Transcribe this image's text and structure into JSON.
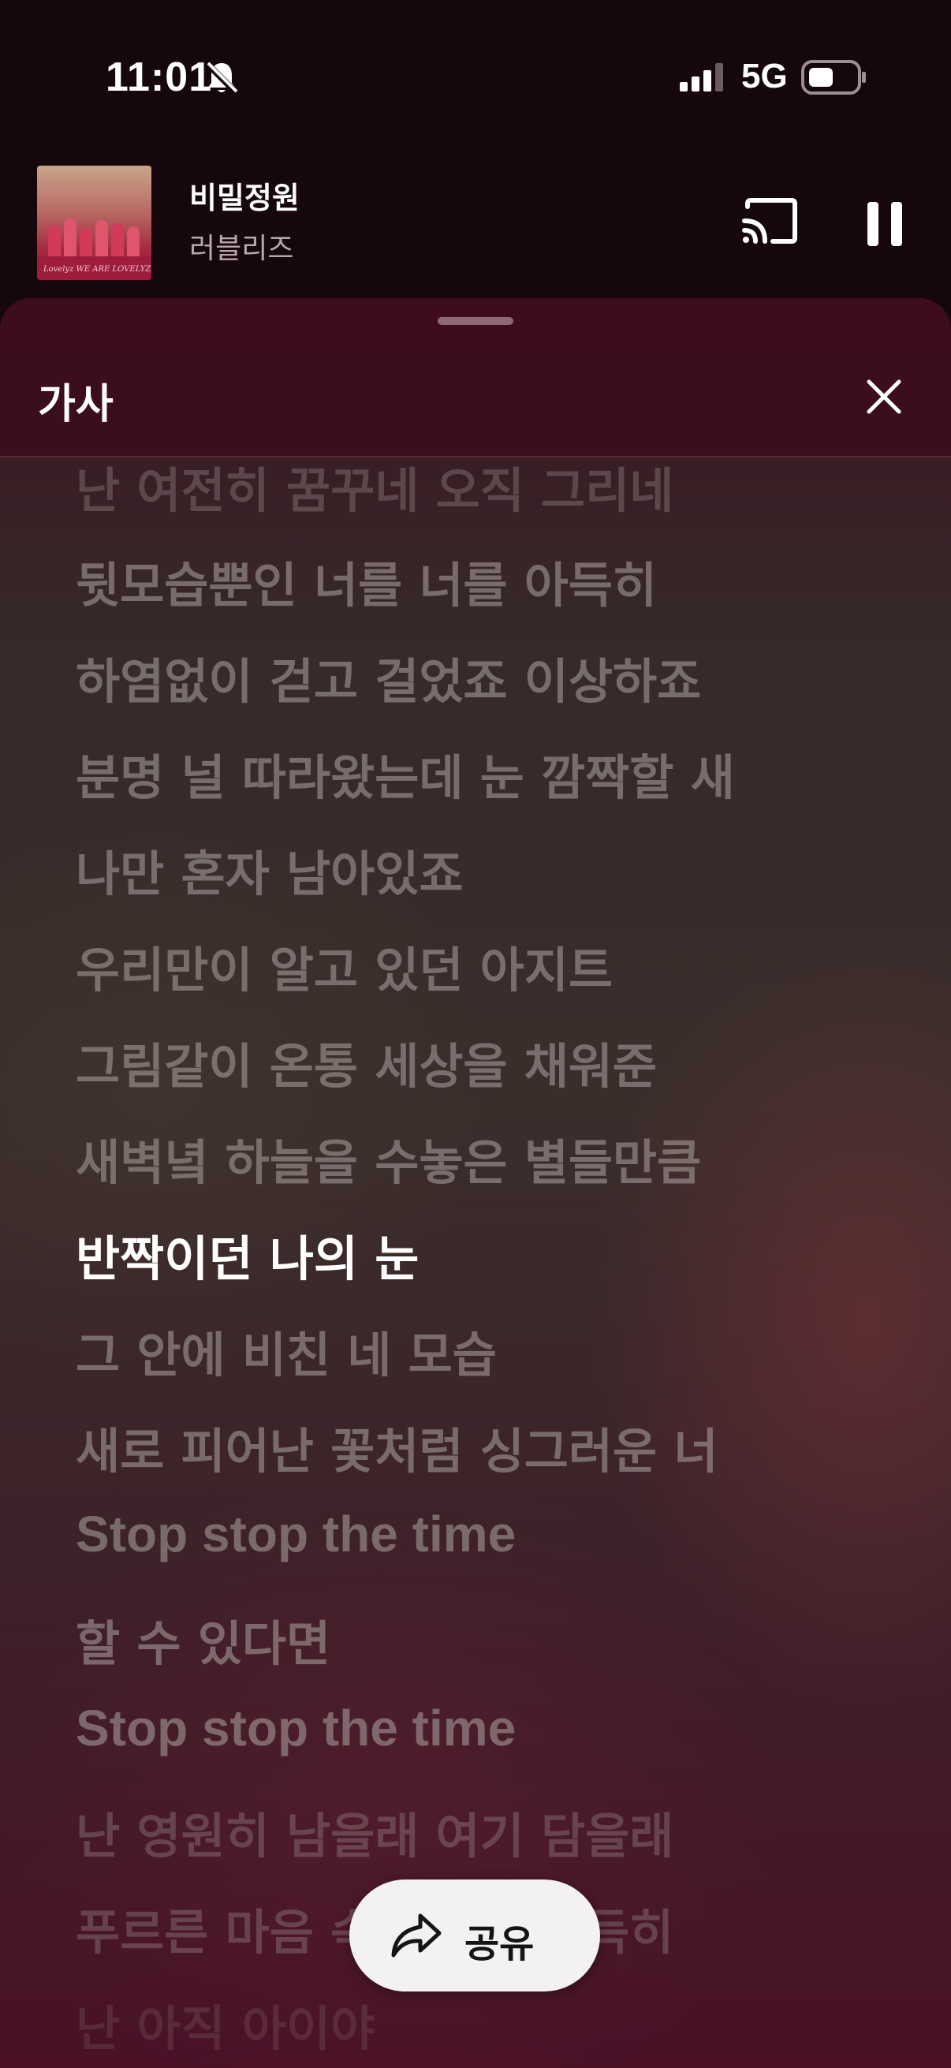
{
  "status_bar": {
    "time": "11:01",
    "network": "5G",
    "icons": [
      "bell-slash-icon",
      "signal-bars-icon",
      "battery-icon"
    ]
  },
  "now_playing": {
    "title": "비밀정원",
    "artist": "러블리즈",
    "art_text": "Lovelyz  WE ARE LOVELYZ"
  },
  "lyrics_sheet": {
    "title": "가사",
    "lines": [
      "난 여전히 꿈꾸네 오직 그리네",
      "뒷모습뿐인 너를 너를 아득히",
      "하염없이 걷고 걸었죠 이상하죠",
      "분명 널 따라왔는데 눈 깜짝할 새",
      "나만 혼자 남아있죠",
      "우리만이 알고 있던 아지트",
      "그림같이 온통 세상을 채워준",
      "새벽녘 하늘을 수놓은 별들만큼",
      "반짝이던 나의 눈",
      "그 안에 비친 네 모습",
      "새로 피어난 꽃처럼 싱그러운 너",
      "Stop stop the time",
      "할 수 있다면",
      "Stop stop the time",
      "난 영원히 남을래 여기 담을래",
      "푸르른 마음 속에 너를 아득히",
      "난 아직 아이야"
    ],
    "active_index": 8,
    "share_label": "공유"
  },
  "colors": {
    "background": "#16070d",
    "sheet_header": "#3e0c1d",
    "active_lyric": "#ffffff",
    "inactive_lyric": "#a09696"
  }
}
